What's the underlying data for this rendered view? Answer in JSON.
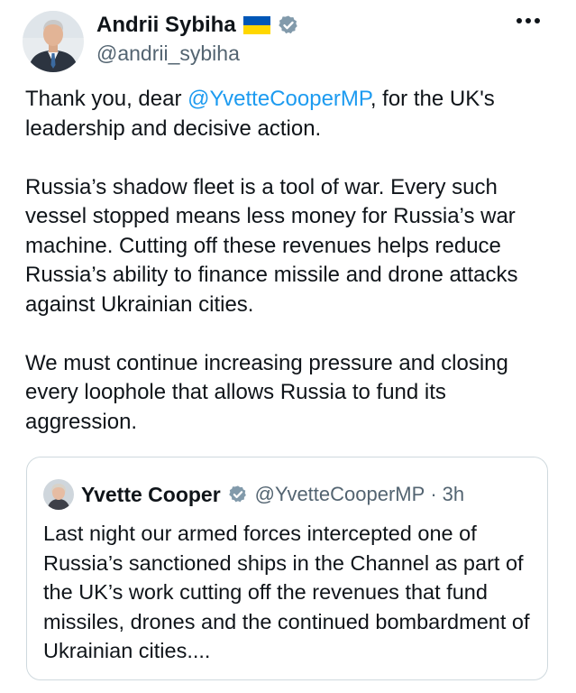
{
  "author": {
    "name": "Andrii Sybiha",
    "handle": "@andrii_sybiha",
    "flag_icon": "ukraine-flag-icon",
    "verified_icon": "verified-badge-icon"
  },
  "more_icon": "more-dots-icon",
  "tweet": {
    "p1_before": "Thank you, dear ",
    "p1_mention": "@YvetteCooperMP",
    "p1_after": ", for the UK's leadership and decisive action.",
    "p2": "Russia’s shadow fleet is a tool of war. Every such vessel stopped means less money for Russia’s war machine. Cutting off these revenues helps reduce Russia’s ability to finance missile and drone attacks against Ukrainian cities.",
    "p3": "We must continue increasing pressure and closing every loophole that allows Russia to fund its aggression."
  },
  "quote": {
    "name": "Yvette Cooper",
    "handle": "@YvetteCooperMP",
    "separator": "·",
    "time": "3h",
    "text": "Last night our armed forces intercepted one of Russia’s sanctioned ships in the Channel as part of the UK’s work cutting off the revenues that fund missiles, drones and the continued bombardment of Ukrainian cities...."
  },
  "colors": {
    "text": "#0f1419",
    "secondary": "#536471",
    "link": "#1d9bf0",
    "verified": "#829aab",
    "border": "#cfd9de",
    "flag_blue": "#0057b7",
    "flag_yellow": "#ffd700"
  }
}
